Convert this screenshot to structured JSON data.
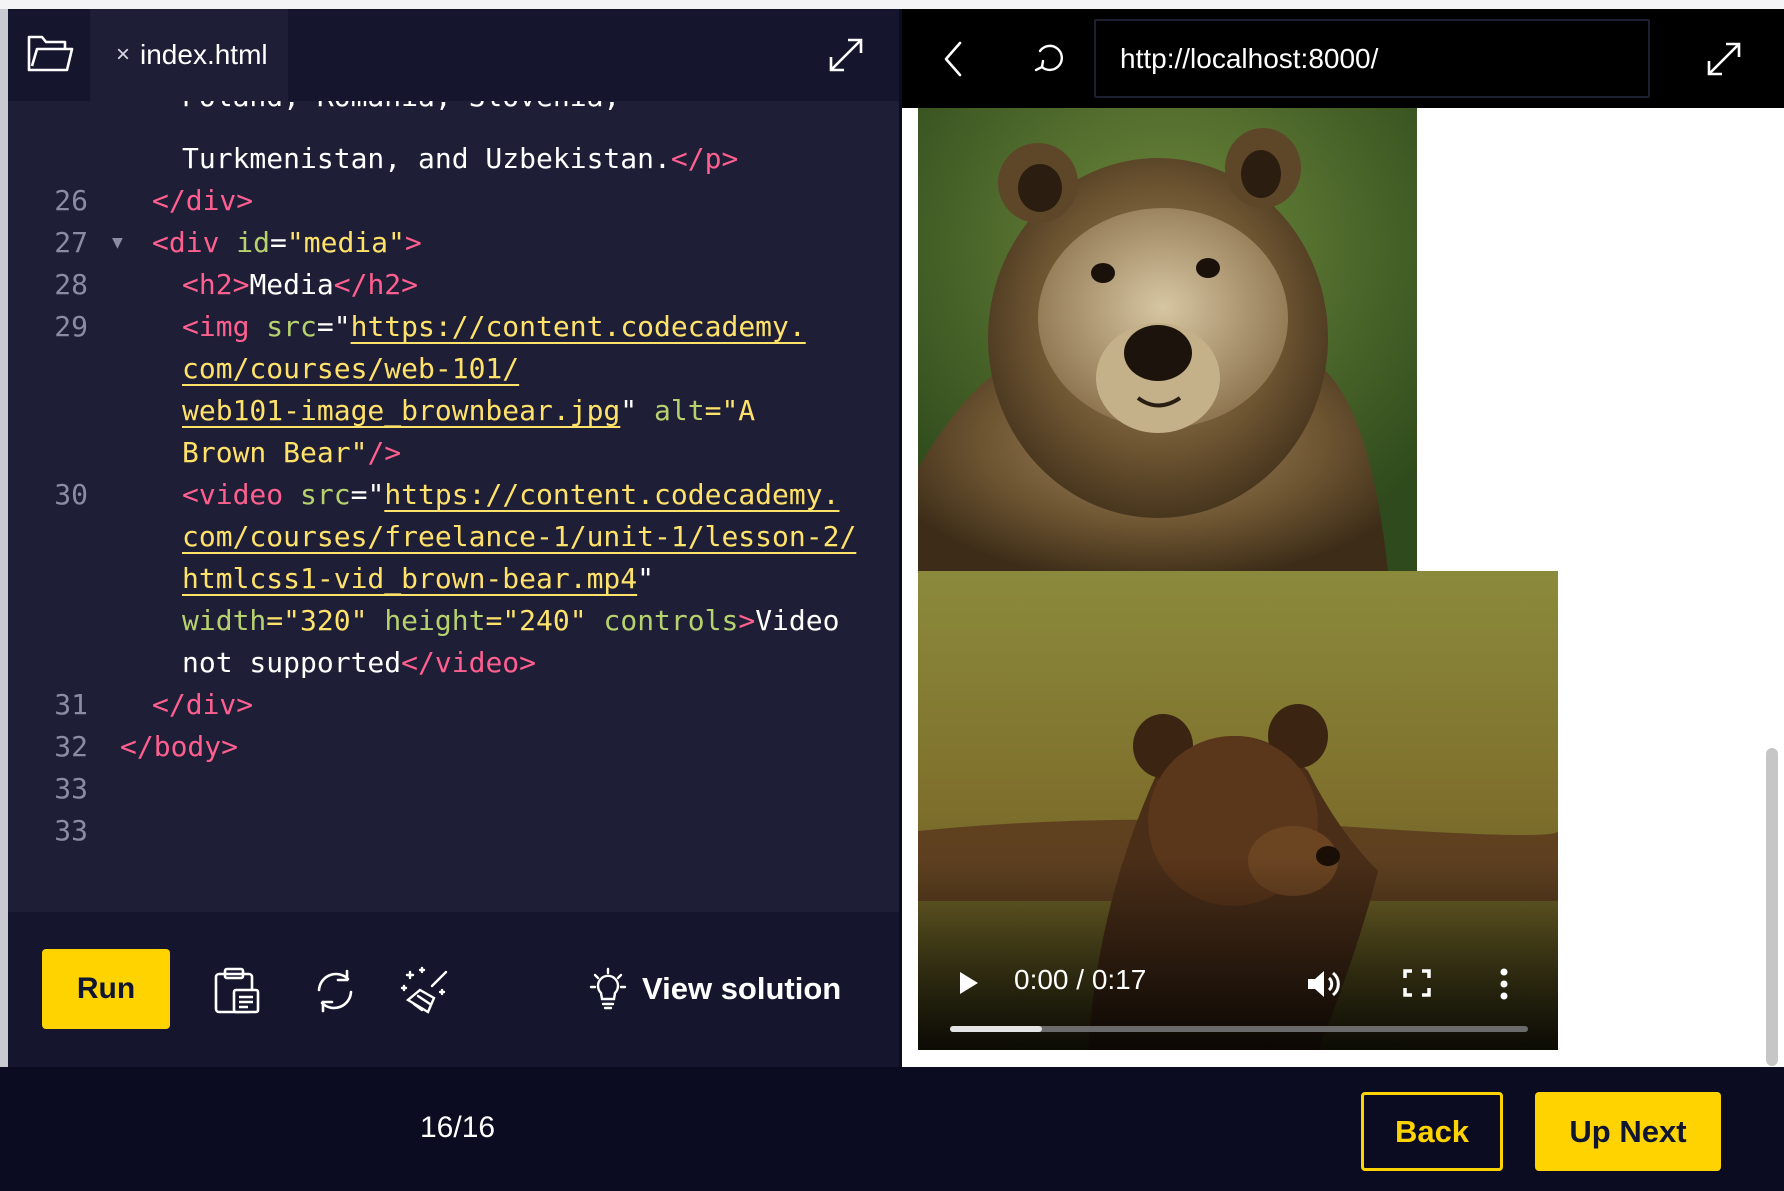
{
  "editor": {
    "file_tab": "index.html",
    "close_glyph": "×",
    "code_lines": [
      {
        "text": "Turkmenistan, and Uzbekistan."
      },
      {
        "num": "26"
      },
      {
        "num": "27"
      },
      {
        "num": "28"
      },
      {
        "num": "29"
      },
      {
        "num": "30"
      },
      {
        "num": "31"
      },
      {
        "num": "32"
      },
      {
        "num": "33"
      }
    ],
    "code": {
      "l25_text": "Turkmenistan, and Uzbekistan.",
      "l25_close": "</p>",
      "l26": "</div>",
      "l27_open": "<div ",
      "l27_attr": "id",
      "l27_eq": "=",
      "l27_val": "\"media\"",
      "l27_close": ">",
      "l28_open": "<h2>",
      "l28_text": "Media",
      "l28_close": "</h2>",
      "l29_open": "<img ",
      "l29_attr": "src",
      "l29_q": "=\"",
      "l29_url1": "https://content.codecademy.",
      "l29_url2": "com/courses/web-101/",
      "l29_url3": "web101-image_brownbear.jpg",
      "l29_q2": "\" ",
      "l29_alt": "alt",
      "l29_altval1": "=\"A",
      "l29_altval2": "Brown Bear\"",
      "l29_end": "/>",
      "l30_open": "<video ",
      "l30_attr": "src",
      "l30_q": "=\"",
      "l30_url1": "https://content.codecademy.",
      "l30_url2": "com/courses/freelance-1/unit-1/lesson-2/",
      "l30_url3": "htmlcss1-vid_brown-bear.mp4",
      "l30_q2": "\"",
      "l30_w": "width",
      "l30_wv": "=\"320\" ",
      "l30_h": "height",
      "l30_hv": "=\"240\" ",
      "l30_c": "controls",
      "l30_gt": ">",
      "l30_t1": "Video",
      "l30_t2": "not supported",
      "l30_close": "</video>",
      "l31": "</div>",
      "l32": "</body>"
    },
    "line_numbers": [
      "26",
      "27",
      "28",
      "29",
      "30",
      "31",
      "32",
      "33"
    ],
    "fold_glyph": "▼"
  },
  "toolbar": {
    "run_label": "Run",
    "view_solution_label": "View solution"
  },
  "browser": {
    "url": "http://localhost:8000/",
    "video_time": "0:00 / 0:17",
    "video_progress_fraction": 0.16
  },
  "footer": {
    "progress": "16/16",
    "back_label": "Back",
    "next_label": "Up Next"
  },
  "colors": {
    "accent": "#ffd300",
    "tag": "#ff5f8f",
    "attribute": "#b6d26e",
    "string": "#ffe26a"
  }
}
